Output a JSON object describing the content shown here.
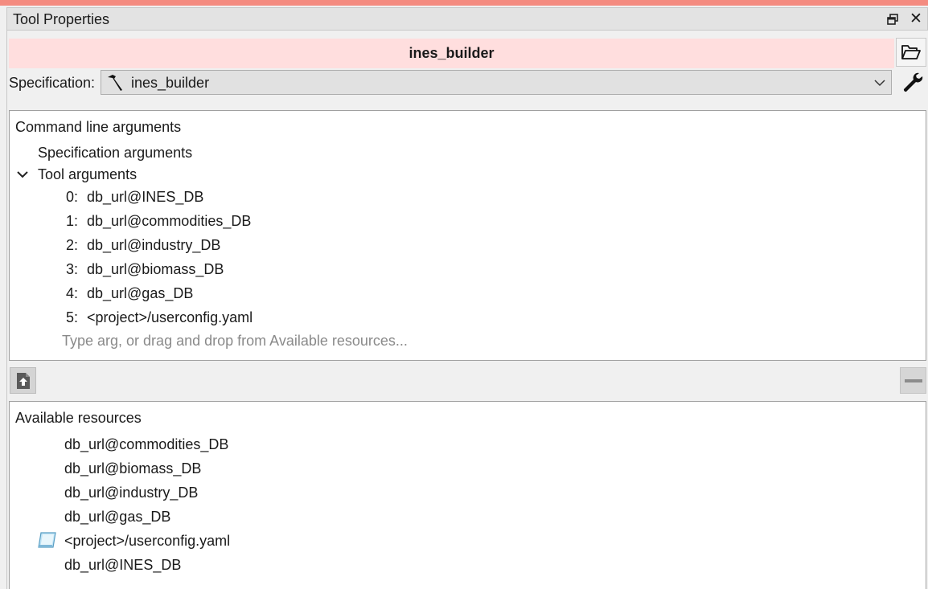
{
  "dock": {
    "title": "Tool Properties",
    "float_icon": "float-window-icon",
    "close_label": "✕"
  },
  "tool": {
    "name": "ines_builder",
    "open_dir_icon": "folder-open-icon"
  },
  "specification": {
    "label": "Specification:",
    "value": "ines_builder",
    "icon": "hammer-icon",
    "edit_icon": "wrench-icon"
  },
  "cmdline": {
    "header": "Command line arguments",
    "spec_args_label": "Specification arguments",
    "tool_args_label": "Tool arguments",
    "tool_args": [
      {
        "index": "0:",
        "value": "db_url@INES_DB"
      },
      {
        "index": "1:",
        "value": "db_url@commodities_DB"
      },
      {
        "index": "2:",
        "value": "db_url@industry_DB"
      },
      {
        "index": "3:",
        "value": "db_url@biomass_DB"
      },
      {
        "index": "4:",
        "value": "db_url@gas_DB"
      },
      {
        "index": "5:",
        "value": "<project>/userconfig.yaml"
      }
    ],
    "placeholder": "Type arg, or drag and drop from Available resources..."
  },
  "actions": {
    "add_icon": "add-arg-icon",
    "remove_icon": "remove-arg-icon"
  },
  "resources": {
    "header": "Available resources",
    "items": [
      "db_url@commodities_DB",
      "db_url@biomass_DB",
      "db_url@industry_DB",
      "db_url@gas_DB",
      "<project>/userconfig.yaml",
      "db_url@INES_DB"
    ]
  },
  "colors": {
    "accent": "#f48b80",
    "banner": "#ffdede"
  }
}
